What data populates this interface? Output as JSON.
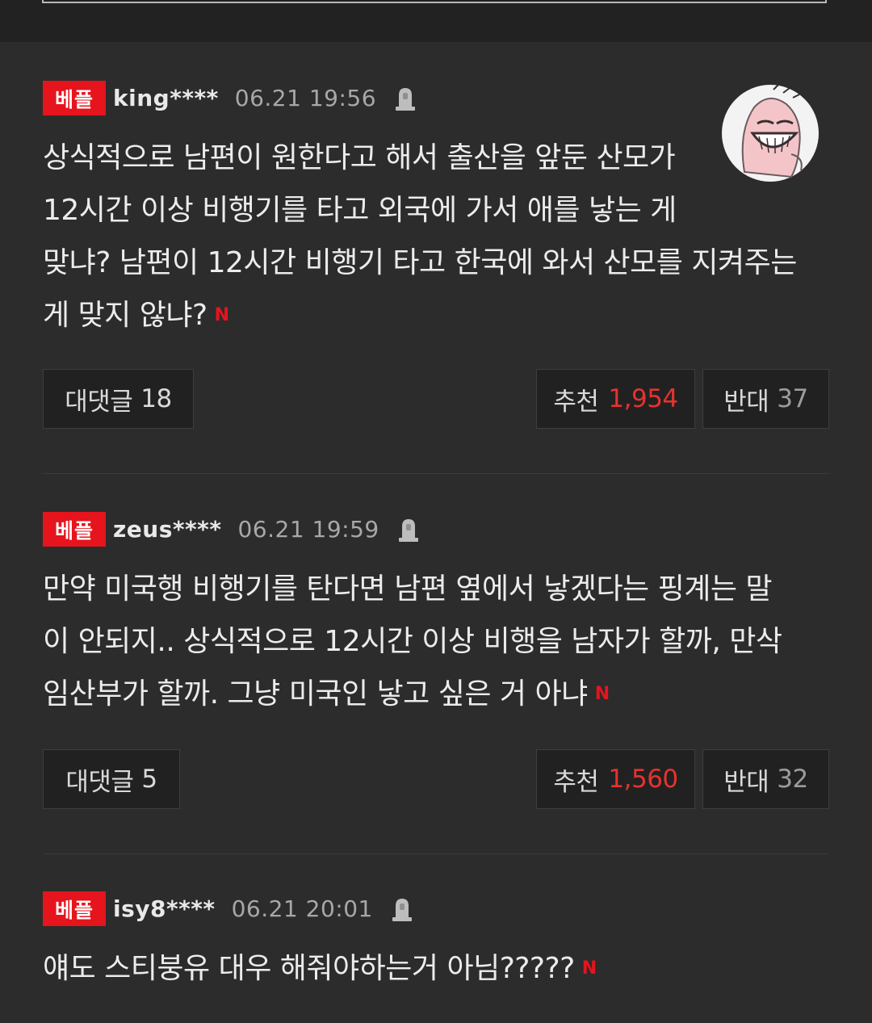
{
  "comments": [
    {
      "badge": "베플",
      "user": "king****",
      "time": "06.21 19:56",
      "lines": [
        "상식적으로 남편이 원한다고 해서 출산을 앞둔 산모가",
        "12시간 이상 비행기를 타고 외국에 가서 애를 낳는 게",
        "맞냐? 남편이 12시간 비행기 타고 한국에 와서 산모를 지켜주는",
        "게 맞지 않냐?"
      ],
      "new_mark": "N",
      "replies_label": "대댓글",
      "replies_count": "18",
      "like_label": "추천",
      "like_count": "1,954",
      "dislike_label": "반대",
      "dislike_count": "37"
    },
    {
      "badge": "베플",
      "user": "zeus****",
      "time": "06.21 19:59",
      "lines": [
        "만약 미국행 비행기를 탄다면 남편 옆에서 낳겠다는 핑계는 말",
        "이 안되지.. 상식적으로 12시간 이상 비행을 남자가 할까, 만삭",
        "임산부가 할까. 그냥 미국인 낳고 싶은 거 아냐"
      ],
      "new_mark": "N",
      "replies_label": "대댓글",
      "replies_count": "5",
      "like_label": "추천",
      "like_count": "1,560",
      "dislike_label": "반대",
      "dislike_count": "32"
    },
    {
      "badge": "베플",
      "user": "isy8****",
      "time": "06.21 20:01",
      "lines": [
        "얘도 스티붕유 대우 해줘야하는거 아님?????"
      ],
      "new_mark": "N"
    }
  ],
  "colors": {
    "background": "#2c2c2c",
    "badge": "#e5141d",
    "like_count": "#e5332e"
  },
  "icons": {
    "report": "bell-report-icon",
    "avatar": "grinning-character-avatar"
  }
}
